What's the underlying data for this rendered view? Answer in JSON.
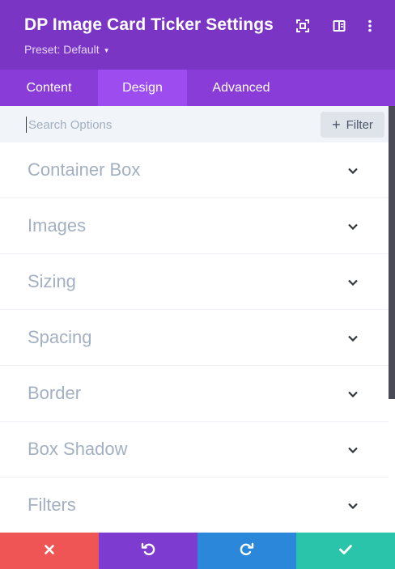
{
  "header": {
    "title": "DP Image Card Ticker Settings",
    "preset_label": "Preset: Default",
    "icons": [
      "expand-icon",
      "split-view-icon",
      "more-vertical-icon"
    ]
  },
  "tabs": [
    {
      "label": "Content",
      "active": false
    },
    {
      "label": "Design",
      "active": true
    },
    {
      "label": "Advanced",
      "active": false
    }
  ],
  "search": {
    "placeholder": "Search Options",
    "value": "",
    "filter_label": "Filter",
    "filter_icon": "plus-icon"
  },
  "toggles": [
    {
      "label": "Container Box"
    },
    {
      "label": "Images"
    },
    {
      "label": "Sizing"
    },
    {
      "label": "Spacing"
    },
    {
      "label": "Border"
    },
    {
      "label": "Box Shadow"
    },
    {
      "label": "Filters"
    }
  ],
  "footer": {
    "buttons": [
      {
        "icon": "close-icon",
        "color": "#ef5555"
      },
      {
        "icon": "undo-icon",
        "color": "#7e3bd0"
      },
      {
        "icon": "redo-icon",
        "color": "#2b87da"
      },
      {
        "icon": "check-icon",
        "color": "#29c4a9"
      }
    ]
  },
  "colors": {
    "header_bg": "#7b35c4",
    "tabs_bg": "#8a3cd9",
    "active_tab_bg": "#9d4cf0",
    "toggle_text": "#a3b0c2",
    "search_bg": "#f1f5f9"
  }
}
